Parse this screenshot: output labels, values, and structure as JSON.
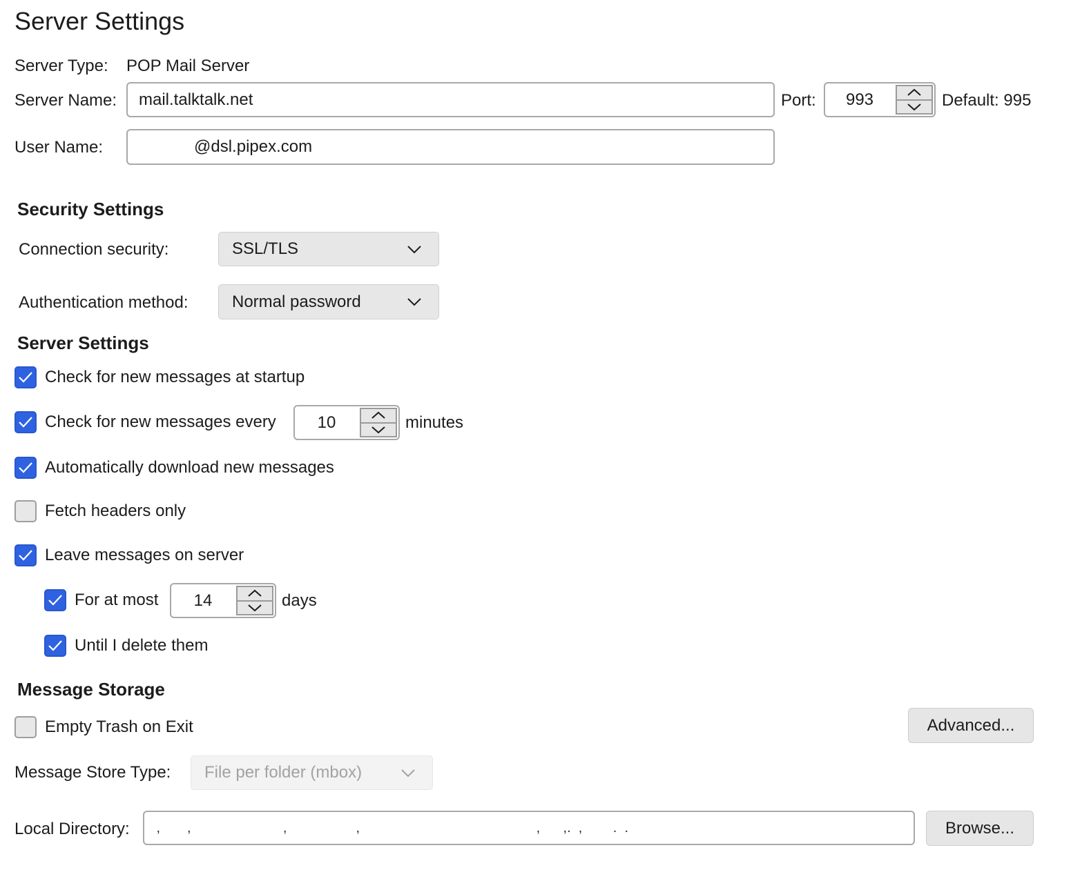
{
  "page_title": "Server Settings",
  "server": {
    "type_label": "Server Type:",
    "type_value": "POP Mail Server",
    "name_label": "Server Name:",
    "name_value": "mail.talktalk.net",
    "port_label": "Port:",
    "port_value": "993",
    "default_port_text": "Default: 995",
    "username_label": "User Name:",
    "username_value": "            @dsl.pipex.com"
  },
  "security": {
    "title": "Security Settings",
    "connection_label": "Connection security:",
    "connection_value": "SSL/TLS",
    "auth_label": "Authentication method:",
    "auth_value": "Normal password"
  },
  "server_settings": {
    "title": "Server Settings",
    "check_startup": {
      "label": "Check for new messages at startup",
      "checked": true
    },
    "check_every": {
      "label": "Check for new messages every",
      "checked": true,
      "value": "10",
      "unit": "minutes"
    },
    "auto_download": {
      "label": "Automatically download new messages",
      "checked": true
    },
    "headers_only": {
      "label": "Fetch headers only",
      "checked": false
    },
    "leave_on_server": {
      "label": "Leave messages on server",
      "checked": true
    },
    "for_at_most": {
      "label": "For at most",
      "checked": true,
      "value": "14",
      "unit": "days"
    },
    "until_delete": {
      "label": "Until I delete them",
      "checked": true
    }
  },
  "storage": {
    "title": "Message Storage",
    "empty_trash": {
      "label": "Empty Trash on Exit",
      "checked": false
    },
    "advanced_button": "Advanced...",
    "store_type_label": "Message Store Type:",
    "store_type_value": "File per folder (mbox)",
    "local_dir_label": "Local Directory:",
    "local_dir_value": " ,       ,                        ,                  ,                                              ,      ,.  ,        .  .",
    "browse_button": "Browse..."
  },
  "colors": {
    "accent": "#2f62e0",
    "checkbox_off": "#e8e8e8",
    "control_bg": "#e6e6e6"
  }
}
